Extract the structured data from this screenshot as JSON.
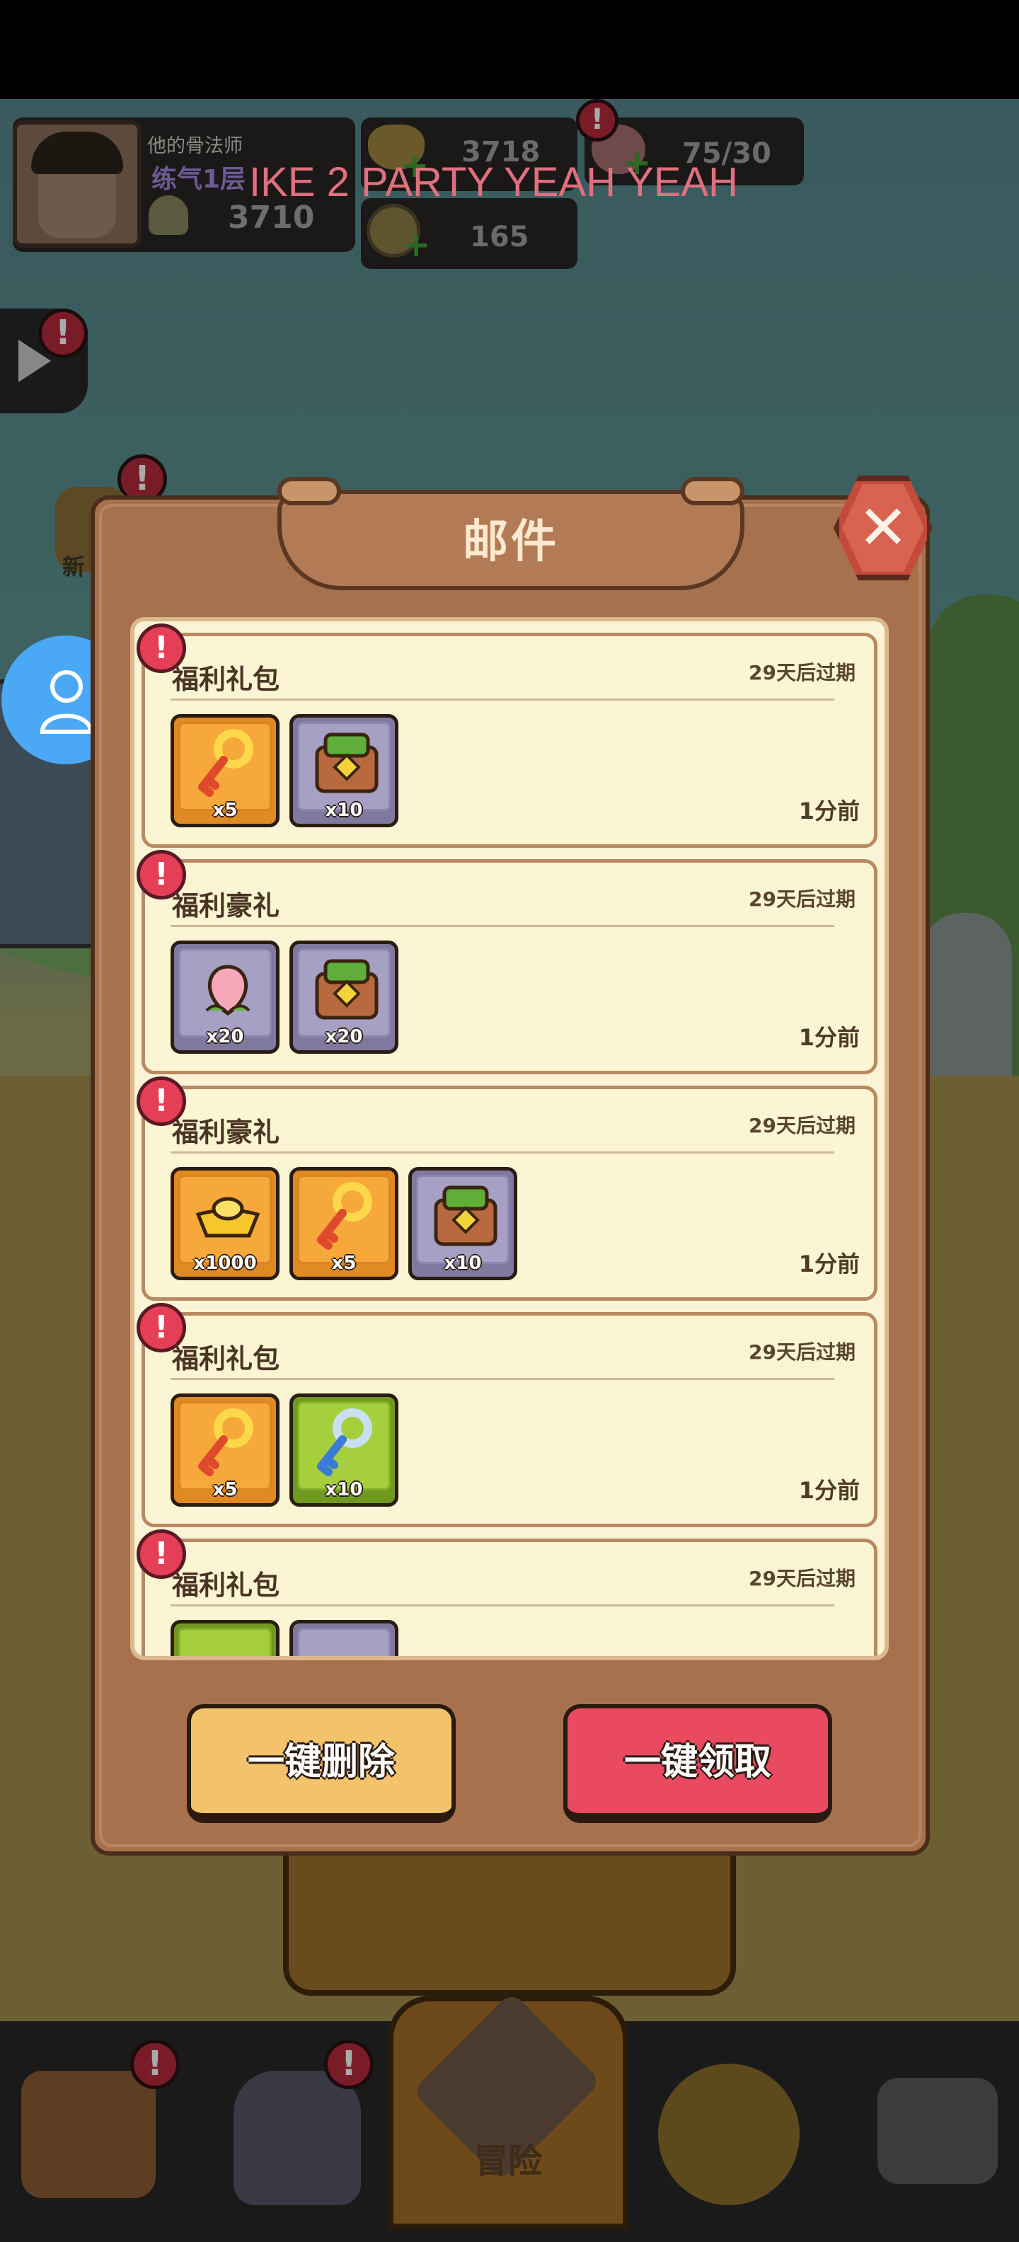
{
  "hud": {
    "player_name": "他的骨法师",
    "player_rank": "练气1层",
    "power": "3710",
    "gold": "3718",
    "stamina": "75/30",
    "coins": "165",
    "marquee": "IKE 2 PARTY YEAH YEAH"
  },
  "side": {
    "new_label": "新"
  },
  "modal": {
    "title": "邮件",
    "close_glyph": "✕",
    "mails": [
      {
        "title": "福利礼包",
        "expire": "29天后过期",
        "time": "1分前",
        "items": [
          {
            "icon": "golden-key",
            "color": "orange",
            "qty": "x5"
          },
          {
            "icon": "treasure-chest",
            "color": "purple",
            "qty": "x10"
          }
        ]
      },
      {
        "title": "福利豪礼",
        "expire": "29天后过期",
        "time": "1分前",
        "items": [
          {
            "icon": "peach",
            "color": "purple",
            "qty": "x20"
          },
          {
            "icon": "treasure-chest",
            "color": "purple",
            "qty": "x20"
          }
        ]
      },
      {
        "title": "福利豪礼",
        "expire": "29天后过期",
        "time": "1分前",
        "items": [
          {
            "icon": "gold-ingot",
            "color": "orange",
            "qty": "x1000"
          },
          {
            "icon": "golden-key",
            "color": "orange",
            "qty": "x5"
          },
          {
            "icon": "treasure-chest",
            "color": "purple",
            "qty": "x10"
          }
        ]
      },
      {
        "title": "福利礼包",
        "expire": "29天后过期",
        "time": "1分前",
        "items": [
          {
            "icon": "golden-key",
            "color": "orange",
            "qty": "x5"
          },
          {
            "icon": "silver-key",
            "color": "green",
            "qty": "x10"
          }
        ]
      },
      {
        "title": "福利礼包",
        "expire": "29天后过期",
        "time": "",
        "items": []
      }
    ],
    "delete_all": "一键删除",
    "claim_all": "一键领取"
  },
  "nav": {
    "adventure": "冒险"
  },
  "colors": {
    "claim_button": "#ea4a60",
    "delete_button": "#f2c36b",
    "modal_bg": "#a7714e",
    "alert": "#e53f57"
  }
}
